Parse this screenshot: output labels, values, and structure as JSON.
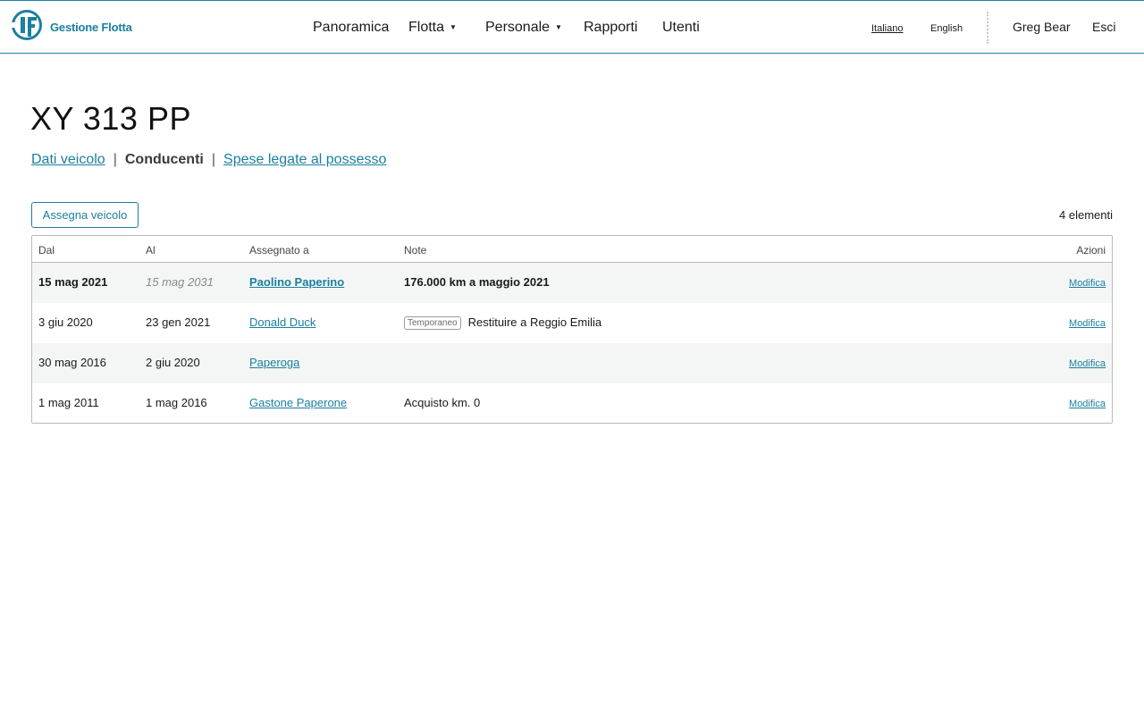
{
  "app": {
    "name": "Gestione Flotta",
    "logo_icon": "gf-logo-icon",
    "accent": "#1b7fa0"
  },
  "nav": {
    "items": [
      {
        "label": "Panoramica",
        "dropdown": false
      },
      {
        "label": "Flotta",
        "dropdown": true
      },
      {
        "label": "Personale",
        "dropdown": true
      },
      {
        "label": "Rapporti",
        "dropdown": false
      },
      {
        "label": "Utenti",
        "dropdown": false
      }
    ],
    "caret": "▼"
  },
  "languages": {
    "italian": "Italiano",
    "english": "English",
    "selected": "Italiano"
  },
  "user": {
    "name": "Greg Bear",
    "logout": "Esci"
  },
  "page": {
    "title": "XY 313 PP",
    "subnav": {
      "vehicle_data": "Dati veicolo",
      "drivers": "Conducenti",
      "ownership_costs": "Spese legate al possesso",
      "separator": "|",
      "current": "Conducenti"
    },
    "assign_button": "Assegna veicolo",
    "count": "4 elementi"
  },
  "table": {
    "headers": {
      "from": "Dal",
      "to": "Al",
      "assigned": "Assegnato a",
      "notes": "Note",
      "actions": "Azioni"
    },
    "rows": [
      {
        "from": "15 mag 2021",
        "to": "15 mag 2031",
        "assigned": "Paolino Paperino",
        "badge": "",
        "notes": "176.000 km a maggio 2021",
        "action": "Modifica",
        "current": true
      },
      {
        "from": "3 giu 2020",
        "to": "23 gen 2021",
        "assigned": "Donald Duck",
        "badge": "Temporaneo",
        "notes": "Restituire a Reggio Emilia",
        "action": "Modifica",
        "current": false
      },
      {
        "from": "30 mag 2016",
        "to": "2 giu 2020",
        "assigned": "Paperoga",
        "badge": "",
        "notes": "",
        "action": "Modifica",
        "current": false
      },
      {
        "from": "1 mag 2011",
        "to": "1 mag 2016",
        "assigned": "Gastone Paperone",
        "badge": "",
        "notes": "Acquisto km. 0",
        "action": "Modifica",
        "current": false
      }
    ]
  }
}
